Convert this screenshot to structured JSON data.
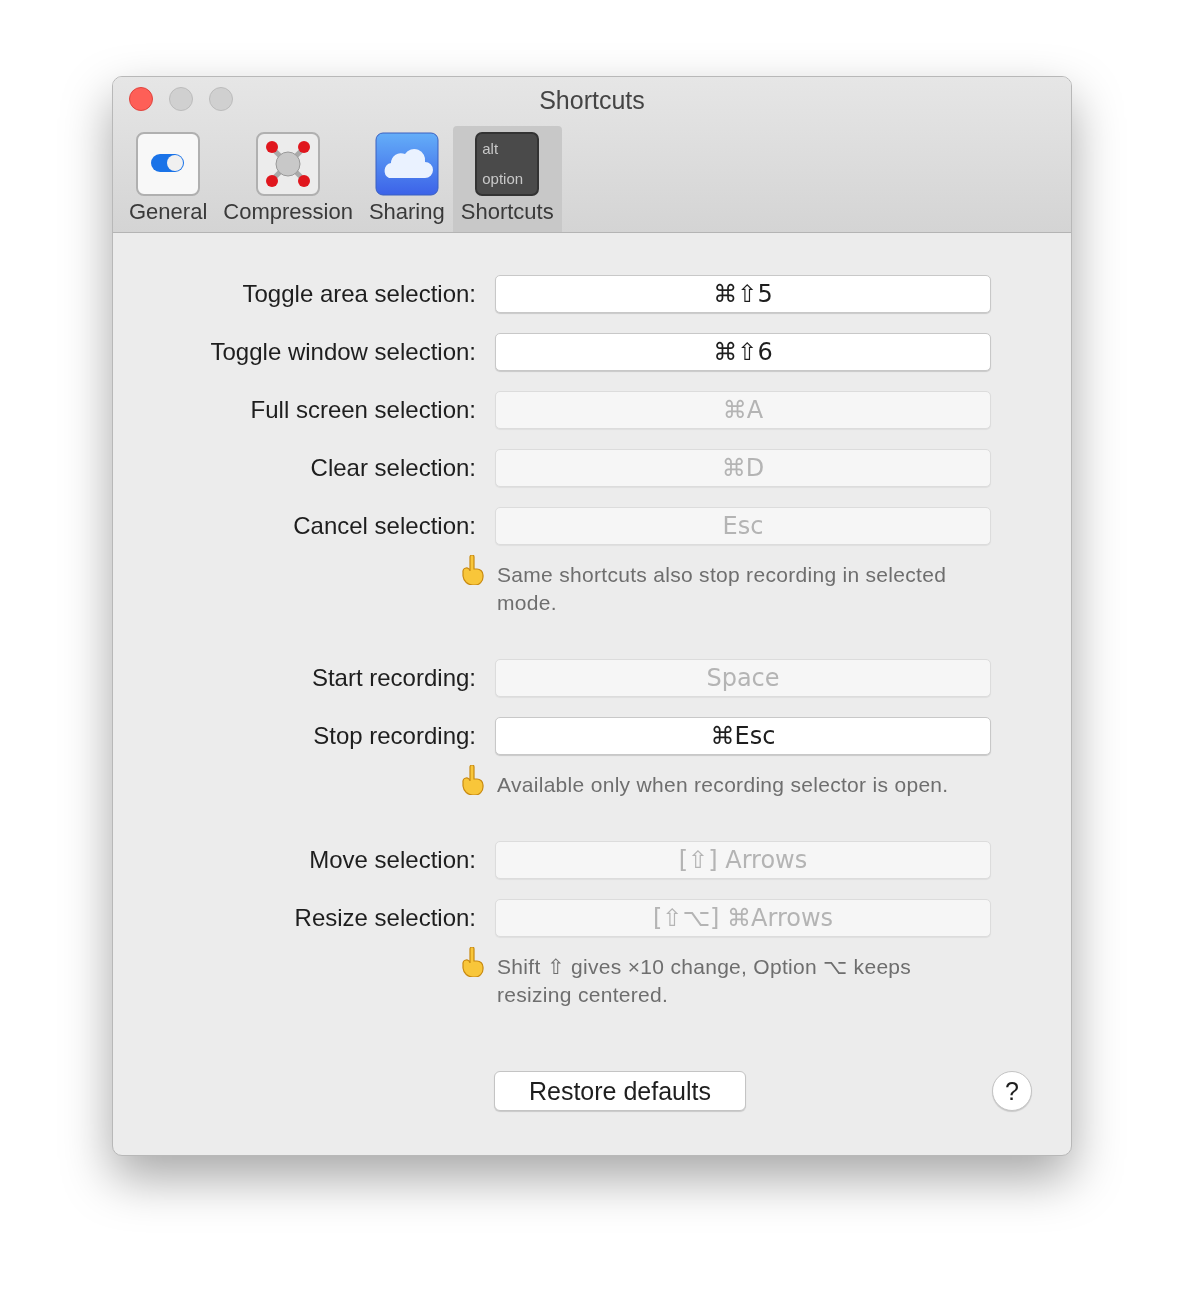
{
  "window": {
    "title": "Shortcuts"
  },
  "tabs": [
    {
      "label": "General",
      "kind": "toggle",
      "selected": false
    },
    {
      "label": "Compression",
      "kind": "molecule",
      "selected": false
    },
    {
      "label": "Sharing",
      "kind": "cloud",
      "selected": false
    },
    {
      "label": "Shortcuts",
      "kind": "key",
      "key_top": "alt",
      "key_bottom": "option",
      "selected": true
    }
  ],
  "sections": [
    {
      "rows": [
        {
          "label": "Toggle area selection:",
          "shortcut": "⌘⇧5",
          "disabled": false
        },
        {
          "label": "Toggle window selection:",
          "shortcut": "⌘⇧6",
          "disabled": false
        },
        {
          "label": "Full screen selection:",
          "shortcut": "⌘A",
          "disabled": true
        },
        {
          "label": "Clear selection:",
          "shortcut": "⌘D",
          "disabled": true
        },
        {
          "label": "Cancel selection:",
          "shortcut": "Esc",
          "disabled": true
        }
      ],
      "note": "Same shortcuts also stop recording in selected mode."
    },
    {
      "rows": [
        {
          "label": "Start recording:",
          "shortcut": "Space",
          "disabled": true
        },
        {
          "label": "Stop recording:",
          "shortcut": "⌘Esc",
          "disabled": false
        }
      ],
      "note": "Available only when recording selector is open."
    },
    {
      "rows": [
        {
          "label": "Move selection:",
          "shortcut": "[⇧] Arrows",
          "disabled": true
        },
        {
          "label": "Resize selection:",
          "shortcut": "[⇧⌥] ⌘Arrows",
          "disabled": true
        }
      ],
      "note": "Shift ⇧ gives ×10 change, Option ⌥ keeps resizing centered."
    }
  ],
  "restore_button": "Restore defaults",
  "help_button": "?"
}
